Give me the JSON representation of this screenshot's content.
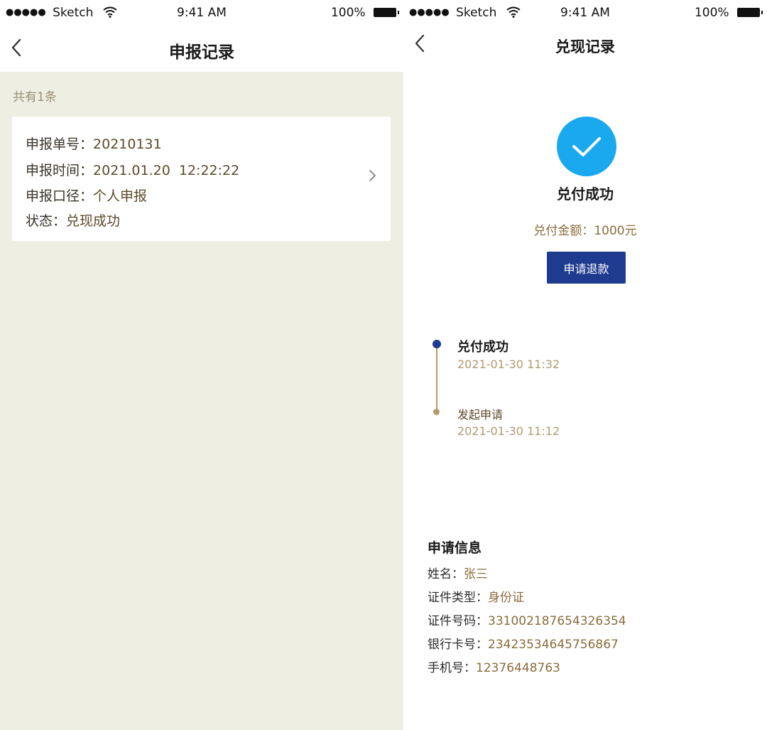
{
  "left": {
    "status_bar": {
      "dots": "●●●●●",
      "carrier": "Sketch",
      "time": "9:41 AM",
      "battery": "100%"
    },
    "nav": {
      "title": "申报记录"
    },
    "count_text": "共有1条",
    "record": {
      "rows": [
        {
          "label": "申报单号：",
          "value": "20210131"
        },
        {
          "label": "申报时间：",
          "value": "2021.01.20  12:22:22"
        },
        {
          "label": "申报口径：",
          "value": "个人申报"
        },
        {
          "label": "状态：",
          "value": "兑现成功"
        }
      ]
    }
  },
  "right": {
    "status_bar": {
      "dots": "●●●●●",
      "carrier": "Sketch",
      "time": "9:41 AM",
      "battery": "100%"
    },
    "nav": {
      "title": "兑现记录"
    },
    "result": {
      "title": "兑付成功",
      "amount": "兑付金额：1000元",
      "button_label": "申请退款"
    },
    "timeline": [
      {
        "title": "兑付成功",
        "time": "2021-01-30 11:32"
      },
      {
        "title": "发起申请",
        "time": "2021-01-30 11:12"
      }
    ],
    "info": {
      "title": "申请信息",
      "rows": [
        {
          "label": "姓名：",
          "value": "张三"
        },
        {
          "label": "证件类型：",
          "value": "身份证"
        },
        {
          "label": "证件号码：",
          "value": "331002187654326354"
        },
        {
          "label": "银行卡号：",
          "value": "23423534645756867"
        },
        {
          "label": "手机号：",
          "value": "12376448763"
        }
      ]
    },
    "colors": {
      "accent": "#1f3b8f",
      "check": "#1aa8ee",
      "gold": "#8a6d3c"
    }
  }
}
